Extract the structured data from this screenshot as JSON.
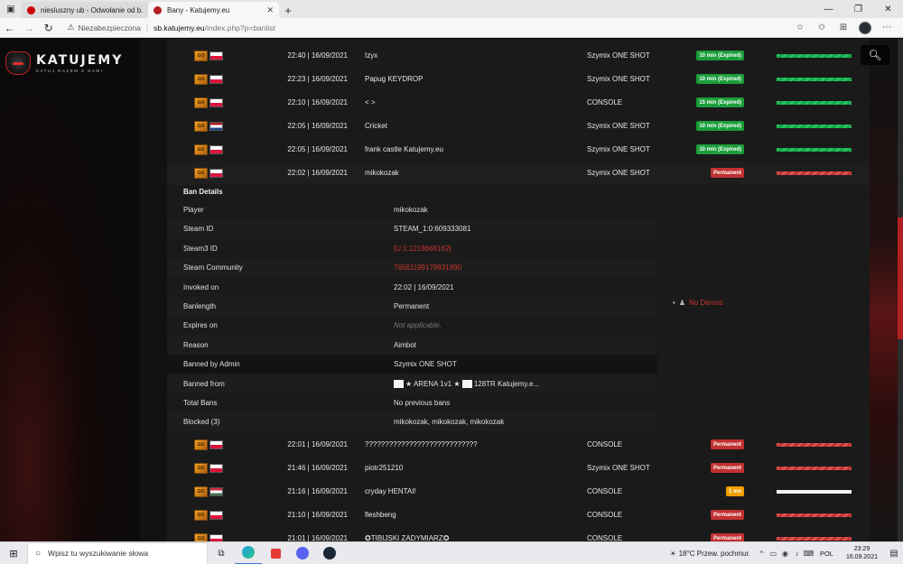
{
  "browser": {
    "tabs": [
      {
        "title": "niesluszny ub - Odwołanie od b...",
        "active": false
      },
      {
        "title": "Bany - Katujemy.eu",
        "active": true
      }
    ],
    "security_label": "Niezabezpieczona",
    "url_host": "sb.katujemy.eu",
    "url_path": "/index.php?p=banlist"
  },
  "site": {
    "brand": "KATUJEMY",
    "slogan": "KATUJ RAZEM Z NAMI"
  },
  "ban_list": {
    "rows_top": [
      {
        "flag": "pl",
        "datetime": "22:40 | 16/09/2021",
        "player": "Izyx",
        "admin": "Szymix ONE SHOT",
        "length": "10 min (Expired)",
        "state": "expired"
      },
      {
        "flag": "pl",
        "datetime": "22:23 | 16/09/2021",
        "player": "Papug KEYDROP",
        "admin": "Szymix ONE SHOT",
        "length": "10 min (Expired)",
        "state": "expired"
      },
      {
        "flag": "pl",
        "datetime": "22:10 | 16/09/2021",
        "player": "< >",
        "admin": "CONSOLE",
        "length": "15 min (Expired)",
        "state": "expired"
      },
      {
        "flag": "nl",
        "datetime": "22:05 | 16/09/2021",
        "player": "Cricket",
        "admin": "Szymix ONE SHOT",
        "length": "10 min (Expired)",
        "state": "expired"
      },
      {
        "flag": "pl",
        "datetime": "22:05 | 16/09/2021",
        "player": "frank castle Katujemy.eu",
        "admin": "Szymix ONE SHOT",
        "length": "10 min (Expired)",
        "state": "expired"
      },
      {
        "flag": "pl",
        "datetime": "22:02 | 16/09/2021",
        "player": "mikokozak",
        "admin": "Szymix ONE SHOT",
        "length": "Permanent",
        "state": "perm"
      }
    ],
    "rows_bottom": [
      {
        "flag": "pl",
        "datetime": "22:01 | 16/09/2021",
        "player": "????????????????????????????",
        "admin": "CONSOLE",
        "length": "Permanent",
        "state": "perm"
      },
      {
        "flag": "pl",
        "datetime": "21:46 | 16/09/2021",
        "player": "piotr251210",
        "admin": "Szymix ONE SHOT",
        "length": "Permanent",
        "state": "perm"
      },
      {
        "flag": "hu",
        "datetime": "21:16 | 16/09/2021",
        "player": "cryday HENTAI!",
        "admin": "CONSOLE",
        "length": "1 mo",
        "state": "active"
      },
      {
        "flag": "pl",
        "datetime": "21:10 | 16/09/2021",
        "player": "fleshbeng",
        "admin": "CONSOLE",
        "length": "Permanent",
        "state": "perm"
      },
      {
        "flag": "pl",
        "datetime": "21:01 | 16/09/2021",
        "player": "✪TIBIJSKI ZADYMIARZ✪",
        "admin": "CONSOLE",
        "length": "Permanent",
        "state": "perm"
      }
    ],
    "game_icon_label": "GO"
  },
  "ban_details": {
    "heading": "Ban Details",
    "fields": [
      {
        "label": "Player",
        "value": "mikokozak",
        "style": "normal"
      },
      {
        "label": "Steam ID",
        "value": "STEAM_1:0:609333081",
        "style": "normal"
      },
      {
        "label": "Steam3 ID",
        "value": "[U:1:1218666162]",
        "style": "link"
      },
      {
        "label": "Steam Community",
        "value": "76561199178931890",
        "style": "link"
      },
      {
        "label": "Invoked on",
        "value": "22:02 | 16/09/2021",
        "style": "normal"
      },
      {
        "label": "Banlength",
        "value": "Permanent",
        "style": "normal"
      },
      {
        "label": "Expires on",
        "value": "Not applicable.",
        "style": "muted"
      },
      {
        "label": "Reason",
        "value": "Aimbot",
        "style": "normal"
      },
      {
        "label": "Banned by Admin",
        "value": "Szymix ONE SHOT",
        "style": "normal"
      },
      {
        "label": "Banned from",
        "value": "★ ARENA 1v1 ★ ",
        "value2": "128TR Katujemy.e...",
        "style": "server"
      },
      {
        "label": "Total Bans",
        "value": "No previous bans",
        "style": "normal"
      },
      {
        "label": "Blocked (3)",
        "value": "mikokozak, mikokozak, mikokozak",
        "style": "normal"
      }
    ],
    "demos_label": "No Demos"
  },
  "taskbar": {
    "search_placeholder": "Wpisz tu wyszukiwanie słowa",
    "weather": "18°C  Przew. pochmur.",
    "language": "POL",
    "time": "23:29",
    "date": "16.09.2021"
  },
  "colors": {
    "expired": "#1a9e3a",
    "permanent": "#c23030",
    "active": "#f0a000",
    "link": "#c9362f"
  }
}
